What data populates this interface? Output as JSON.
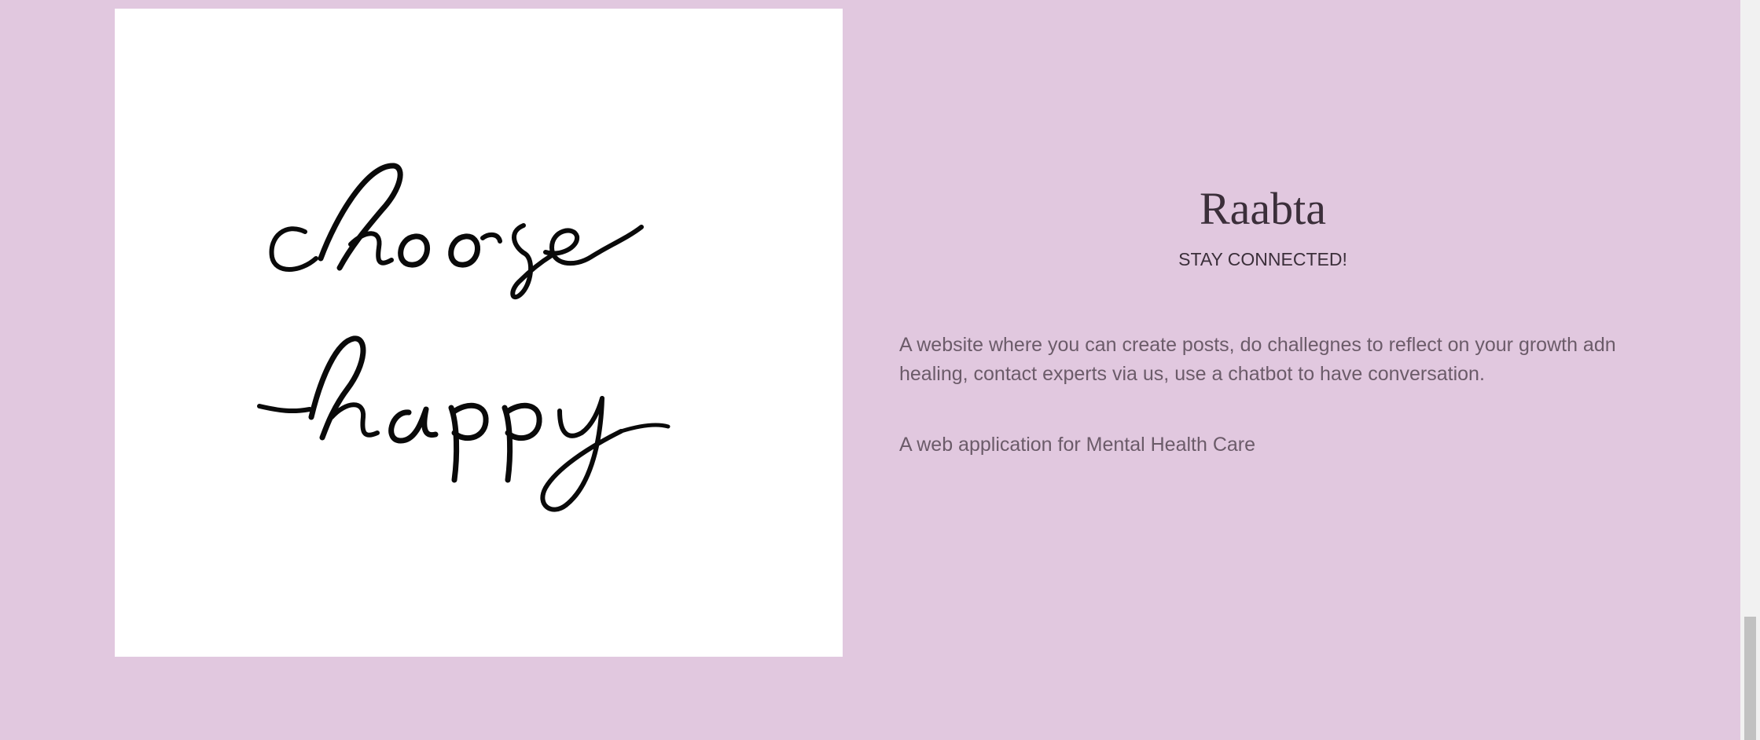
{
  "hero_image": {
    "alt": "choose happy",
    "lettering": [
      "choose",
      "happy"
    ]
  },
  "project": {
    "title": "Raabta",
    "tagline": "STAY CONNECTED!",
    "description": "A website where you can create posts, do challegnes to reflect on your growth adn healing, contact experts via us, use a chatbot to have conversation.",
    "subtitle": "A web application for Mental Health Care"
  },
  "colors": {
    "background": "#e1c8df",
    "title_text": "#3b2f3a",
    "body_text": "#6b5b69",
    "image_background": "#ffffff"
  }
}
